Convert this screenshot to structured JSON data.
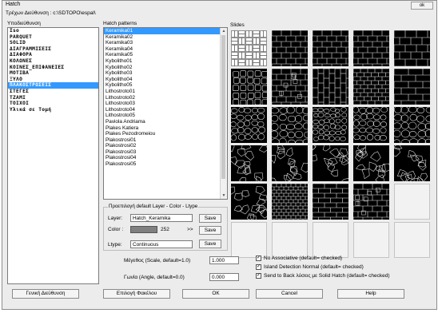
{
  "window": {
    "title": "Hatch",
    "close_label": "ok"
  },
  "path": {
    "label": "Τρέχων Διεύθυνση :",
    "value": "c:\\SDTOPO\\espal\\"
  },
  "folders": {
    "header": "Υποδιεύθυνση",
    "items": [
      "Iso",
      "PARQUET",
      "SOLID",
      "ΔΙΑΓΡΑΜΜΙΣΕΙΣ",
      "ΔΙΑΦΟΡΑ",
      "ΚΟΛΩΝΕΣ",
      "ΚΟΙΝΕΣ_ΕΠΙΦΑΝΕΙΕΣ",
      "ΜΟΤΙΒΑ",
      "ΞΥΛΟ",
      "ΠΛΑΚΟΣΤΡΩΣΕΙΣ",
      "ΣΤΕΓΕΣ",
      "ΤΖΑΜΙ",
      "ΤΟΙΧΟΙ",
      "Υλικά σε Τομή"
    ],
    "selected": 9
  },
  "patterns": {
    "header": "Hatch patterns",
    "items": [
      "Keramika01",
      "Keramika02",
      "Keramika03",
      "Keramika04",
      "Keramika05",
      "Kybolitho01",
      "Kybolitho02",
      "Kybolitho03",
      "Kybolitho04",
      "Kybolitho05",
      "Lithostroto01",
      "Lithostroto02",
      "Lithostroto03",
      "Lithostroto04",
      "Lithostroto05",
      "Paviola Andriama",
      "Plakes Katiera",
      "Plakes Pezodromeiou",
      "Plakostrosi01",
      "Plakostrosi02",
      "Plakostrosi03",
      "Plakostrosi04",
      "Plakostrosi05"
    ],
    "selected": 0
  },
  "slides": {
    "header": "Slides",
    "tiles": [
      "basket",
      "bricks",
      "blocks",
      "bricks-h",
      "bricks-tall",
      "cobble-lg",
      "blocks-mixed",
      "bricks-v",
      "bricks-small",
      "blocks-wide",
      "stones-a",
      "stones-b",
      "stones-c",
      "stones-d",
      "stones-e",
      "crazy-a",
      "crazy-b",
      "crazy-c",
      "crazy-d",
      "crazy-e",
      "crazy-f",
      "grid-dense",
      "slates",
      "paving",
      "empty",
      "empty",
      "empty",
      "empty",
      "empty",
      "empty"
    ]
  },
  "layer_group": {
    "title": "Προεπιλογή default Layer - Color - Ltype",
    "layer_label": "Layer:",
    "layer_value": "Hatch_Keramika",
    "color_label": "Color :",
    "color_value": "252",
    "color_arrow": ">>",
    "ltype_label": "Ltype:",
    "ltype_value": "Continuous",
    "save_label": "Save",
    "swatch_color": "#808080"
  },
  "scale": {
    "label": "Μέγεθος (Scale, default=1.0)",
    "value": "1.000"
  },
  "angle": {
    "label": "Γωνία       (Angle, default=0.0)",
    "value": "0.000"
  },
  "options": [
    {
      "label": "No Associative (default= checked)",
      "checked": true
    },
    {
      "label": "Island Detection Normal    (default= checked)",
      "checked": true
    },
    {
      "label": "Send to Back λύσεις με Solid Hatch (default= checked)",
      "checked": true
    }
  ],
  "buttons": {
    "current_dir": "Γενική Διεύθυνση",
    "pick_file": "Επιλογή Φακέλου",
    "ok": "OK",
    "cancel": "Cancel",
    "help": "Help"
  }
}
